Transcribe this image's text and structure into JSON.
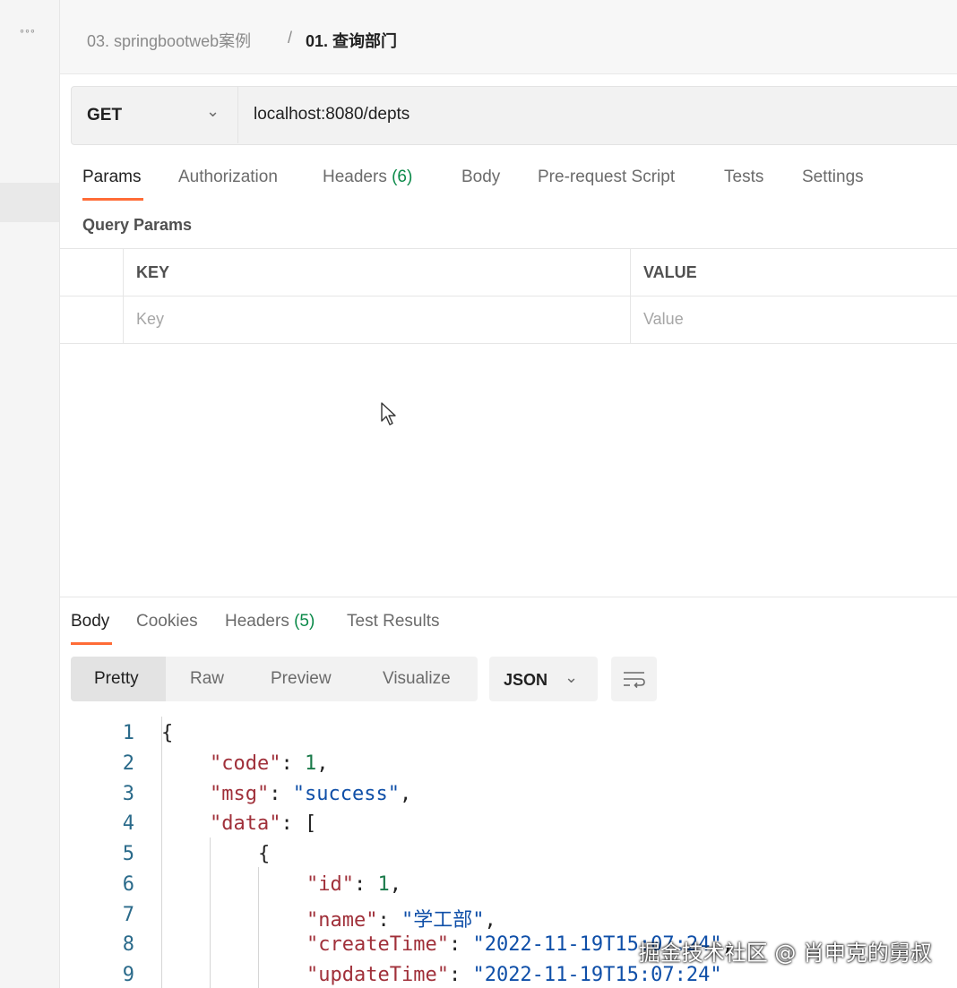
{
  "rail": {
    "more_glyph": "◦◦◦"
  },
  "breadcrumb": {
    "parent": "03. springbootweb案例",
    "separator": "/",
    "current": "01. 查询部门"
  },
  "request": {
    "method": "GET",
    "url": "localhost:8080/depts"
  },
  "request_tabs": {
    "params": "Params",
    "authorization": "Authorization",
    "headers": "Headers",
    "headers_count": "(6)",
    "body": "Body",
    "pre_request": "Pre-request Script",
    "tests": "Tests",
    "settings": "Settings"
  },
  "query_params": {
    "label": "Query Params",
    "columns": {
      "key": "KEY",
      "value": "VALUE"
    },
    "placeholders": {
      "key": "Key",
      "value": "Value"
    }
  },
  "response_tabs": {
    "body": "Body",
    "cookies": "Cookies",
    "headers": "Headers",
    "headers_count": "(5)",
    "test_results": "Test Results"
  },
  "view_modes": {
    "pretty": "Pretty",
    "raw": "Raw",
    "preview": "Preview",
    "visualize": "Visualize"
  },
  "format": {
    "selected": "JSON"
  },
  "code": {
    "line_numbers": [
      "1",
      "2",
      "3",
      "4",
      "5",
      "6",
      "7",
      "8",
      "9"
    ],
    "l1_brace": "{",
    "l2_key": "\"code\"",
    "l2_colon": ": ",
    "l2_val": "1",
    "l2_end": ",",
    "l3_key": "\"msg\"",
    "l3_colon": ": ",
    "l3_val": "\"success\"",
    "l3_end": ",",
    "l4_key": "\"data\"",
    "l4_rest": ": [",
    "l5_brace": "{",
    "l6_key": "\"id\"",
    "l6_colon": ": ",
    "l6_val": "1",
    "l6_end": ",",
    "l7_key": "\"name\"",
    "l7_colon": ": ",
    "l7_val": "\"学工部\"",
    "l7_end": ",",
    "l8_key": "\"createTime\"",
    "l8_colon": ": ",
    "l8_val": "\"2022-11-19T15:07:24\"",
    "l8_end": ",",
    "l9_key": "\"updateTime\"",
    "l9_colon": ": ",
    "l9_val": "\"2022-11-19T15:07:24\""
  },
  "watermark": "掘金技术社区 @ 肖申克的舅叔",
  "colors": {
    "accent": "#ff6c37",
    "count_green": "#0c8a4a",
    "json_key": "#a0303a",
    "json_string": "#0f4fa8",
    "json_number": "#1a7a4a"
  },
  "icons": {
    "rail": "more-dots-icon",
    "method_dropdown": "chevron-down-icon",
    "format_dropdown": "chevron-down-icon",
    "wrap": "wrap-lines-icon",
    "pointer": "mouse-cursor-icon"
  }
}
